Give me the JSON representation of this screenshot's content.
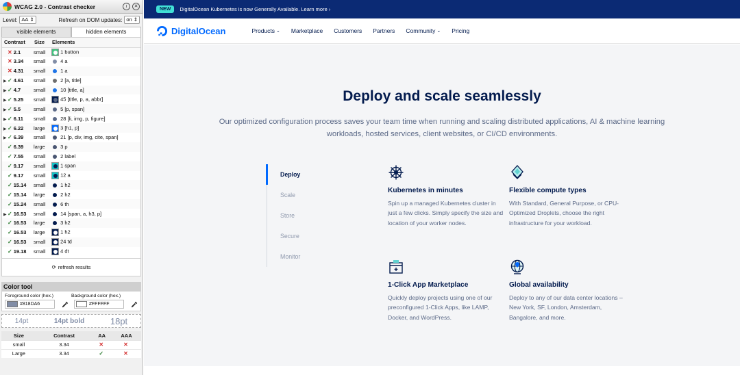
{
  "checker": {
    "title": "WCAG 2.0 - Contrast checker",
    "level_label": "Level:",
    "level_value": "AA",
    "refresh_label": "Refresh on DOM updates:",
    "refresh_value": "on",
    "tabs": [
      "visible elements",
      "hidden elements"
    ],
    "columns": [
      "Contrast",
      "Size",
      "Elements"
    ],
    "rows": [
      {
        "expand": "",
        "status": "fail",
        "contrast": "2.1",
        "size": "small",
        "swatch": "#41c27f",
        "dot": "#ffffff",
        "boxed": true,
        "elements": "1 button"
      },
      {
        "expand": "",
        "status": "fail",
        "contrast": "3.34",
        "size": "small",
        "swatch": "",
        "dot": "#818da6",
        "boxed": false,
        "elements": "4 a"
      },
      {
        "expand": "",
        "status": "fail",
        "contrast": "4.31",
        "size": "small",
        "swatch": "",
        "dot": "#1f74e6",
        "boxed": false,
        "elements": "1 a"
      },
      {
        "expand": "▸",
        "status": "pass",
        "contrast": "4.61",
        "size": "small",
        "swatch": "",
        "dot": "#6e6e6e",
        "boxed": false,
        "elements": "2 [a, title]"
      },
      {
        "expand": "▸",
        "status": "pass",
        "contrast": "4.7",
        "size": "small",
        "swatch": "",
        "dot": "#1f74e6",
        "boxed": false,
        "elements": "10 [title, a]"
      },
      {
        "expand": "▸",
        "status": "pass",
        "contrast": "5.25",
        "size": "small",
        "swatch": "#031b4e",
        "dot": "#5b6987",
        "boxed": true,
        "elements": "45 [title, p, a, abbr]"
      },
      {
        "expand": "▸",
        "status": "pass",
        "contrast": "5.5",
        "size": "small",
        "swatch": "",
        "dot": "#5b6987",
        "boxed": false,
        "elements": "5 [p, span]"
      },
      {
        "expand": "▸",
        "status": "pass",
        "contrast": "6.11",
        "size": "small",
        "swatch": "",
        "dot": "#5b6987",
        "boxed": false,
        "elements": "28 [li, img, p, figure]"
      },
      {
        "expand": "▸",
        "status": "pass",
        "contrast": "6.22",
        "size": "large",
        "swatch": "#0069ff",
        "dot": "#ffffff",
        "boxed": true,
        "elements": "3 [h1, p]"
      },
      {
        "expand": "▸",
        "status": "pass",
        "contrast": "6.39",
        "size": "small",
        "swatch": "",
        "dot": "#4a5672",
        "boxed": false,
        "elements": "21 [p, div, img, cite, span]"
      },
      {
        "expand": "",
        "status": "pass",
        "contrast": "6.39",
        "size": "large",
        "swatch": "",
        "dot": "#4a5672",
        "boxed": false,
        "elements": "3 p"
      },
      {
        "expand": "",
        "status": "pass",
        "contrast": "7.55",
        "size": "small",
        "swatch": "",
        "dot": "#4a5672",
        "boxed": false,
        "elements": "2 label"
      },
      {
        "expand": "",
        "status": "pass",
        "contrast": "9.17",
        "size": "small",
        "swatch": "#15c2c6",
        "dot": "#031b4e",
        "boxed": true,
        "elements": "1 span"
      },
      {
        "expand": "",
        "status": "pass",
        "contrast": "9.17",
        "size": "small",
        "swatch": "#15c2c6",
        "dot": "#031b4e",
        "boxed": true,
        "elements": "12 a"
      },
      {
        "expand": "",
        "status": "pass",
        "contrast": "15.14",
        "size": "small",
        "swatch": "",
        "dot": "#031b4e",
        "boxed": false,
        "elements": "1 h2"
      },
      {
        "expand": "",
        "status": "pass",
        "contrast": "15.14",
        "size": "large",
        "swatch": "",
        "dot": "#031b4e",
        "boxed": false,
        "elements": "2 h2"
      },
      {
        "expand": "",
        "status": "pass",
        "contrast": "15.24",
        "size": "small",
        "swatch": "",
        "dot": "#031b4e",
        "boxed": false,
        "elements": "6 th"
      },
      {
        "expand": "▸",
        "status": "pass",
        "contrast": "16.53",
        "size": "small",
        "swatch": "",
        "dot": "#031b4e",
        "boxed": false,
        "elements": "14 [span, a, h3, p]"
      },
      {
        "expand": "",
        "status": "pass",
        "contrast": "16.53",
        "size": "large",
        "swatch": "",
        "dot": "#031b4e",
        "boxed": false,
        "elements": "3 h2"
      },
      {
        "expand": "",
        "status": "pass",
        "contrast": "16.53",
        "size": "large",
        "swatch": "#031b4e",
        "dot": "#ffffff",
        "boxed": true,
        "elements": "1 h2"
      },
      {
        "expand": "",
        "status": "pass",
        "contrast": "16.53",
        "size": "small",
        "swatch": "#031b4e",
        "dot": "#ffffff",
        "boxed": true,
        "elements": "24 td"
      },
      {
        "expand": "",
        "status": "pass",
        "contrast": "19.18",
        "size": "small",
        "swatch": "#031b4e",
        "dot": "#ffffff",
        "boxed": true,
        "elements": "4 dt"
      }
    ],
    "refresh_results": "refresh results",
    "color_tool": {
      "title": "Color tool",
      "fg_label": "Foreground color (hex.)",
      "bg_label": "Background color (hex.)",
      "fg_value": "#818DA6",
      "bg_value": "#FFFFFF",
      "fg_color": "#818DA6",
      "bg_color": "#FFFFFF",
      "samples": [
        "14pt",
        "14pt bold",
        "18pt"
      ],
      "summary_headers": [
        "Size",
        "Contrast",
        "AA",
        "AAA"
      ],
      "summary_rows": [
        {
          "size": "small",
          "contrast": "3.34",
          "aa": "fail",
          "aaa": "fail"
        },
        {
          "size": "Large",
          "contrast": "3.34",
          "aa": "pass",
          "aaa": "fail"
        }
      ]
    }
  },
  "site": {
    "banner_badge": "NEW",
    "banner_text": "DigitalOcean Kubernetes is now Generally Available. Learn more ›",
    "brand": "DigitalOcean",
    "nav": [
      "Products",
      "Marketplace",
      "Customers",
      "Partners",
      "Community",
      "Pricing"
    ],
    "hero_title": "Deploy and scale seamlessly",
    "hero_sub": "Our optimized configuration process saves your team time when running and scaling distributed applications, AI & machine learning workloads, hosted services, client websites, or CI/CD environments.",
    "feature_tabs": [
      "Deploy",
      "Scale",
      "Store",
      "Secure",
      "Monitor"
    ],
    "cards": [
      {
        "icon": "helm-wheel-icon",
        "title": "Kubernetes in minutes",
        "text": "Spin up a managed Kubernetes cluster in just a few clicks. Simply specify the size and location of your worker nodes."
      },
      {
        "icon": "droplet-icon",
        "title": "Flexible compute types",
        "text": "With Standard, General Purpose, or CPU-Optimized Droplets, choose the right infrastructure for your workload."
      },
      {
        "icon": "app-box-icon",
        "title": "1-Click App Marketplace",
        "text": "Quickly deploy projects using one of our preconfigured 1-Click Apps, like LAMP, Docker, and WordPress."
      },
      {
        "icon": "globe-pin-icon",
        "title": "Global availability",
        "text": "Deploy to any of our data center locations – New York, SF, London, Amsterdam, Bangalore, and more."
      }
    ],
    "accent": "#0069ff",
    "heading_color": "#031b4e"
  }
}
